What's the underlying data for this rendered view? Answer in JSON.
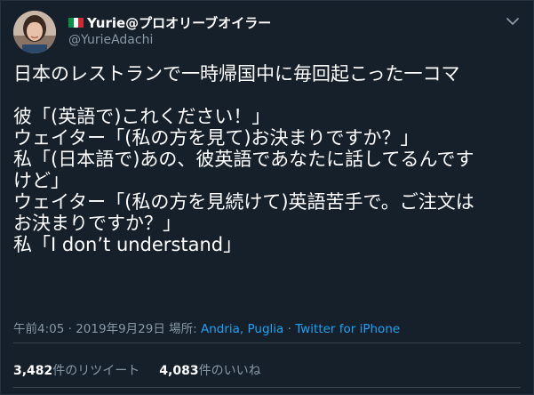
{
  "user": {
    "display_name": "Yurie@プロオリーブオイラー",
    "handle": "@YurieAdachi",
    "flag_colors": [
      "#009246",
      "#ffffff",
      "#ce2b37"
    ]
  },
  "tweet": {
    "text": "日本のレストランで一時帰国中に毎回起こった一コマ\n\n彼「(英語で)これください！」\nウェイター「(私の方を見て)お決まりですか？」\n私「(日本語で)あの、彼英語であなたに話してるんです\nけど」\nウェイター「(私の方を見続けて)英語苦手で。ご注文は\nお決まりですか？」\n私「I don’t understand」"
  },
  "meta": {
    "time": "午前4:05",
    "separator": "·",
    "date": "2019年9月29日",
    "place_label": "場所:",
    "place": "Andria, Puglia",
    "client": "Twitter for iPhone"
  },
  "stats": {
    "retweets_count": "3,482",
    "retweets_unit": "件の",
    "retweets_label": "リツイート",
    "likes_count": "4,083",
    "likes_unit": "件の",
    "likes_label": "いいね"
  },
  "colors": {
    "background": "#15202b",
    "text": "#ffffff",
    "secondary": "#8899a6",
    "link": "#1da1f2",
    "divider": "#38444d"
  },
  "icons": {
    "avatar": "profile-photo",
    "menu": "chevron-down-icon",
    "flag": "italy-flag-icon"
  }
}
